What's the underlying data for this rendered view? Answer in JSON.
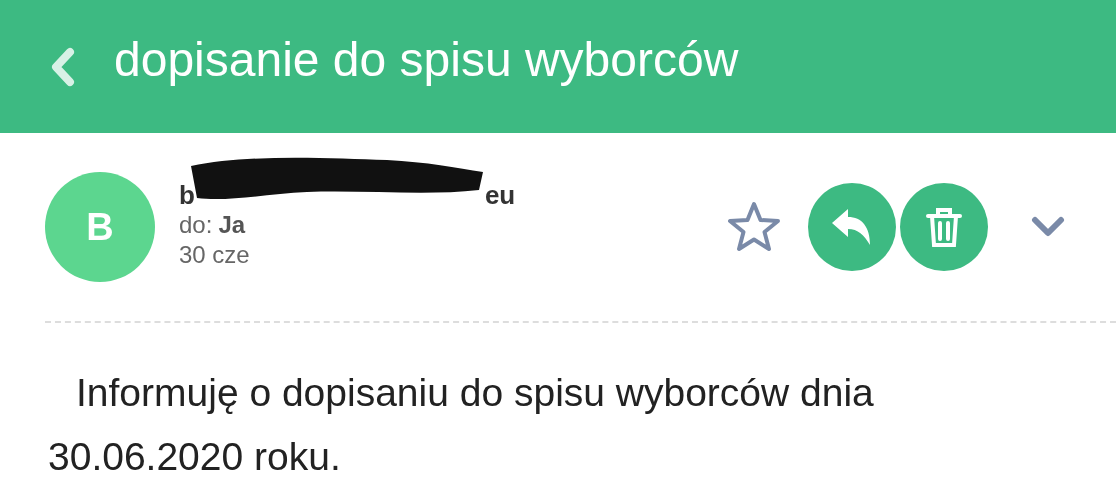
{
  "header": {
    "title": "dopisanie do spisu wyborców"
  },
  "message": {
    "avatar": "B",
    "sender_start": "b",
    "sender_end": "eu",
    "sender_redacted": true,
    "to_label": "do:",
    "to": "Ja",
    "date": "30 cze",
    "starred": false
  },
  "body": "Informuję o dopisaniu do spisu wyborców dnia 30.06.2020 roku."
}
